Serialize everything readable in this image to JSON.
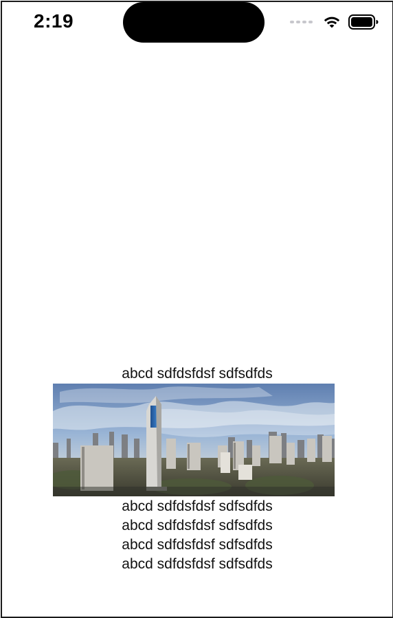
{
  "status_bar": {
    "time": "2:19",
    "icons": [
      "cellular-dots-icon",
      "wifi-icon",
      "battery-icon"
    ]
  },
  "content": {
    "lines_above": [
      "abcd sdfdsfdsf sdfsdfds"
    ],
    "image": {
      "name": "city-skyline-panorama"
    },
    "lines_below": [
      "abcd sdfdsfdsf sdfsdfds",
      "abcd sdfdsfdsf sdfsdfds",
      "abcd sdfdsfdsf sdfsdfds",
      "abcd sdfdsfdsf sdfsdfds"
    ]
  }
}
